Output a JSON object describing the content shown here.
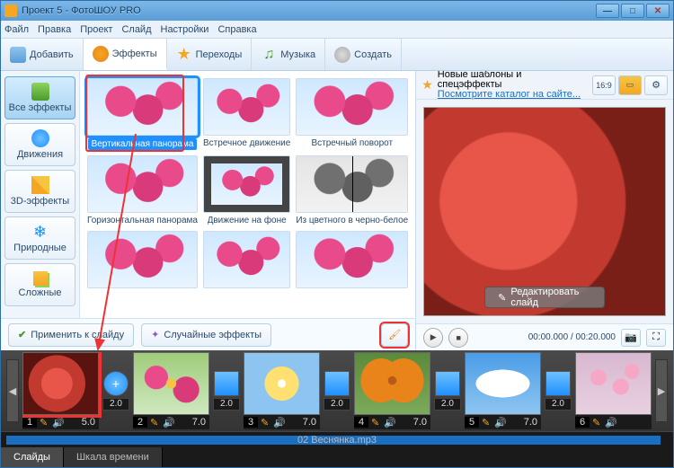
{
  "window": {
    "title": "Проект 5 - ФотоШОУ PRO"
  },
  "menu": [
    "Файл",
    "Правка",
    "Проект",
    "Слайд",
    "Настройки",
    "Справка"
  ],
  "tabs": {
    "add": "Добавить",
    "effects": "Эффекты",
    "transitions": "Переходы",
    "music": "Музыка",
    "create": "Создать"
  },
  "categories": {
    "all": "Все эффекты",
    "motion": "Движения",
    "d3": "3D-эффекты",
    "nature": "Природные",
    "complex": "Сложные"
  },
  "effects": [
    {
      "label": "Вертикальная панорама",
      "sel": true
    },
    {
      "label": "Встречное движение"
    },
    {
      "label": "Встречный поворот"
    },
    {
      "label": "Горизонтальная панорама"
    },
    {
      "label": "Движение на фоне"
    },
    {
      "label": "Из цветного в черно-белое"
    },
    {
      "label": ""
    },
    {
      "label": ""
    },
    {
      "label": ""
    }
  ],
  "actions": {
    "apply": "Применить к слайду",
    "random": "Случайные эффекты"
  },
  "promo": {
    "line1": "Новые шаблоны и спецэффекты",
    "line2": "Посмотрите каталог на сайте..."
  },
  "aspect": "16:9",
  "editSlide": "Редактировать слайд",
  "time": "00:00.000 / 00:20.000",
  "timeline": [
    {
      "n": "1",
      "dur": "5.0",
      "cls": "rose",
      "sel": true,
      "tdur": "2.0",
      "trans": "circ"
    },
    {
      "n": "2",
      "dur": "7.0",
      "cls": "flw2",
      "tdur": "2.0",
      "trans": "sq"
    },
    {
      "n": "3",
      "dur": "7.0",
      "cls": "sun",
      "tdur": "2.0",
      "trans": "sq"
    },
    {
      "n": "4",
      "dur": "7.0",
      "cls": "bfly",
      "tdur": "2.0",
      "trans": "sq"
    },
    {
      "n": "5",
      "dur": "7.0",
      "cls": "sky",
      "tdur": "2.0",
      "trans": "sq"
    },
    {
      "n": "6",
      "dur": "",
      "cls": "sakura"
    }
  ],
  "audio": "02 Веснянка.mp3",
  "bottomTabs": {
    "slides": "Слайды",
    "timeline": "Шкала времени"
  }
}
